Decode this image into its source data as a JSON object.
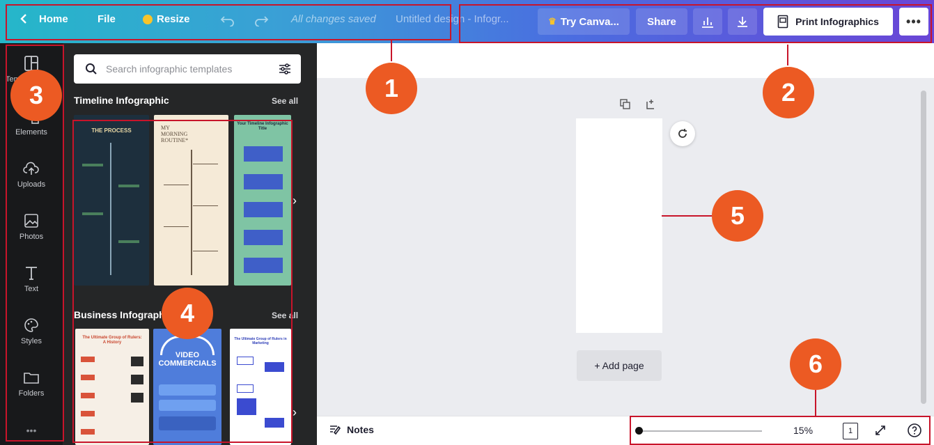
{
  "topbar": {
    "home_label": "Home",
    "file_label": "File",
    "resize_label": "Resize",
    "saved_status": "All changes saved",
    "doc_title": "Untitled design - Infogr...",
    "try_canva_label": "Try Canva...",
    "share_label": "Share",
    "print_label": "Print Infographics",
    "more_label": "•••"
  },
  "rail": {
    "items": [
      {
        "label": "Templates",
        "icon": "templates-icon"
      },
      {
        "label": "Elements",
        "icon": "elements-icon"
      },
      {
        "label": "Uploads",
        "icon": "upload-cloud-icon"
      },
      {
        "label": "Photos",
        "icon": "photo-icon"
      },
      {
        "label": "Text",
        "icon": "text-icon"
      },
      {
        "label": "Styles",
        "icon": "palette-icon"
      },
      {
        "label": "Folders",
        "icon": "folder-icon"
      }
    ],
    "more_label": "•••"
  },
  "panel": {
    "search_placeholder": "Search infographic templates",
    "sections": [
      {
        "title": "Timeline Infographic",
        "see_all": "See all",
        "thumbs": [
          "THE PROCESS",
          "MY MORNING ROUTINE*",
          "Your Timeline Infographic Title"
        ]
      },
      {
        "title": "Business Infographic",
        "see_all": "See all",
        "thumbs": [
          "The Ultimate Group of Rulers: A History",
          "VIDEO COMMERCIALS",
          "The Ultimate Group of Rulers in Marketing"
        ]
      }
    ]
  },
  "canvas": {
    "add_page_label": "+ Add page"
  },
  "bottombar": {
    "notes_label": "Notes",
    "zoom_value": "15%",
    "zoom_fraction": 0.02,
    "page_count": "1"
  },
  "annotations": [
    "1",
    "2",
    "3",
    "4",
    "5",
    "6"
  ],
  "colors": {
    "accent_red": "#c8142a",
    "badge_orange": "#ec5a23",
    "topbar_start": "#25b7c9",
    "topbar_end": "#6a45d6",
    "rail_bg": "#18191b",
    "panel_bg": "#252627"
  }
}
